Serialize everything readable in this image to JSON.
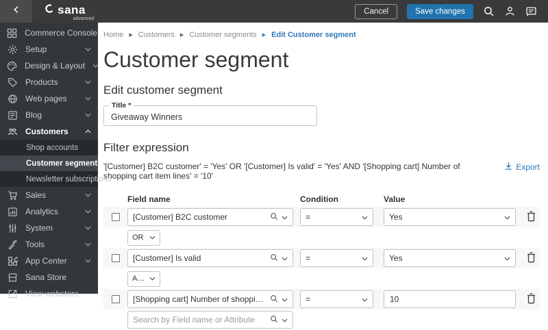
{
  "topbar": {
    "logo": "sana",
    "logo_sub": "advanced",
    "cancel_label": "Cancel",
    "save_label": "Save changes",
    "icons": [
      "back-icon",
      "search-icon",
      "user-icon",
      "chat-icon"
    ],
    "accent_color": "#2173ae"
  },
  "sidebar": {
    "background_color": "#33373c",
    "items": [
      {
        "label": "Commerce Console",
        "icon": "dashboard-icon",
        "expandable": false
      },
      {
        "label": "Setup",
        "icon": "gear-icon",
        "expandable": true
      },
      {
        "label": "Design & Layout",
        "icon": "palette-icon",
        "expandable": true
      },
      {
        "label": "Products",
        "icon": "tag-icon",
        "expandable": true
      },
      {
        "label": "Web pages",
        "icon": "globe-icon",
        "expandable": true
      },
      {
        "label": "Blog",
        "icon": "blog-icon",
        "expandable": true
      },
      {
        "label": "Customers",
        "icon": "people-icon",
        "expandable": true,
        "expanded": true,
        "children": [
          {
            "label": "Shop accounts",
            "active": false
          },
          {
            "label": "Customer segments",
            "active": true
          },
          {
            "label": "Newsletter subscriptions",
            "active": false
          }
        ]
      },
      {
        "label": "Sales",
        "icon": "cart-icon",
        "expandable": true
      },
      {
        "label": "Analytics",
        "icon": "bar-chart-icon",
        "expandable": true
      },
      {
        "label": "System",
        "icon": "sliders-icon",
        "expandable": true
      },
      {
        "label": "Tools",
        "icon": "wrench-icon",
        "expandable": true
      },
      {
        "label": "App Center",
        "icon": "apps-icon",
        "expandable": true
      },
      {
        "label": "Sana Store",
        "icon": "store-icon",
        "expandable": false
      },
      {
        "label": "View webstore",
        "icon": "external-link-icon",
        "expandable": false
      }
    ]
  },
  "breadcrumb": {
    "items": [
      "Home",
      "Customers",
      "Customer segments",
      "Edit Customer segment"
    ],
    "active_color": "#2e77b6"
  },
  "page": {
    "title": "Customer segment",
    "edit_section_title": "Edit customer segment",
    "title_field": {
      "label": "Title *",
      "value": "Giveaway Winners"
    },
    "filter_section_title": "Filter expression",
    "expression": "'[Customer] B2C customer' = 'Yes' OR '[Customer] Is valid' = 'Yes' AND '[Shopping cart] Number of shopping cart item lines' = '10'",
    "export_label": "Export",
    "table": {
      "headers": [
        "Field name",
        "Condition",
        "Value"
      ],
      "rows": [
        {
          "field": "[Customer] B2C customer",
          "condition": "=",
          "value": "Yes",
          "operator_after": "OR"
        },
        {
          "field": "[Customer] Is valid",
          "condition": "=",
          "value": "Yes",
          "operator_after": "AND"
        },
        {
          "field": "[Shopping cart] Number of shopping cart item lines",
          "condition": "=",
          "value": "10"
        }
      ],
      "search_placeholder": "Search by Field name or Attribute"
    }
  }
}
